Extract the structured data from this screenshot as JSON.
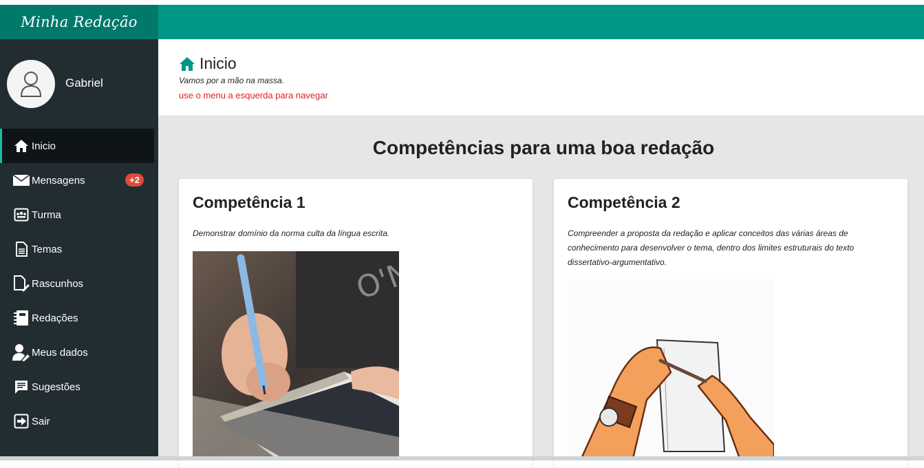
{
  "app": {
    "brand": "Minha Redação"
  },
  "user": {
    "name": "Gabriel"
  },
  "menu": {
    "items": [
      {
        "label": "Inicio",
        "icon": "home-icon"
      },
      {
        "label": "Mensagens",
        "icon": "envelope-icon",
        "badge": "+2"
      },
      {
        "label": "Turma",
        "icon": "class-icon"
      },
      {
        "label": "Temas",
        "icon": "document-icon"
      },
      {
        "label": "Rascunhos",
        "icon": "draft-icon"
      },
      {
        "label": "Redações",
        "icon": "notebook-icon"
      },
      {
        "label": "Meus dados",
        "icon": "user-edit-icon"
      },
      {
        "label": "Sugestões",
        "icon": "comment-icon"
      },
      {
        "label": "Sair",
        "icon": "logout-icon"
      }
    ]
  },
  "header": {
    "title": "Inicio",
    "subtitle": "Vamos por a mão na massa.",
    "hint": "use o menu a esquerda para navegar"
  },
  "main": {
    "section_title": "Competências para uma boa redação",
    "cards": [
      {
        "title": "Competência 1",
        "text": "Demonstrar domínio da norma culta da língua escrita."
      },
      {
        "title": "Competência 2",
        "text": "Compreender a proposta da redação e aplicar conceitos das várias áreas de conhecimento para desenvolver o tema, dentro dos limites estruturais do texto dissertativo-argumentativo."
      }
    ]
  },
  "colors": {
    "brand": "#01796a",
    "topbar": "#009688",
    "sidebar": "#222d32",
    "hint": "#e02020",
    "badge": "#dd4b39"
  }
}
